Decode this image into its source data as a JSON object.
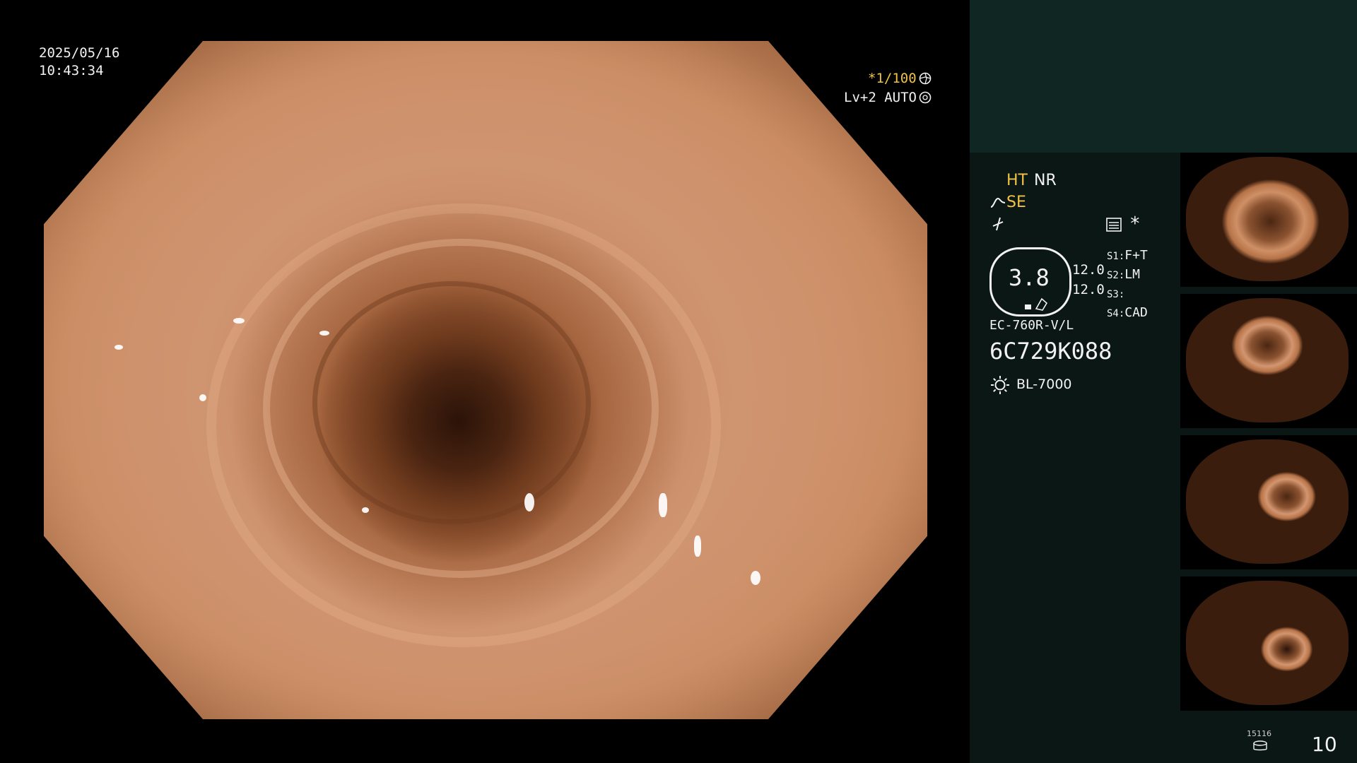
{
  "datetime": {
    "date": "2025/05/16",
    "time": "10:43:34"
  },
  "shutter": {
    "value": "*1/100",
    "icon": "shutter-icon"
  },
  "iris": {
    "value": "Lv+2 AUTO",
    "icon": "iris-icon"
  },
  "enhancement": {
    "ht": "HT",
    "nr": "NR",
    "se": "SE",
    "se_icon": "enhance-curve-icon",
    "color_icon": "color-mode-icon",
    "aux_icon": "image-mode-icon",
    "star": "*"
  },
  "zoom": {
    "value": "3.8",
    "ratio_a": "12.0",
    "ratio_b": "12.0"
  },
  "switches": [
    {
      "key": "S1:",
      "value": "F+T"
    },
    {
      "key": "S2:",
      "value": "LM"
    },
    {
      "key": "S3:",
      "value": ""
    },
    {
      "key": "S4:",
      "value": "CAD"
    }
  ],
  "scope": {
    "model": "EC-760R-V/L",
    "serial": "6C729K088"
  },
  "light_source": {
    "name": "BL-7000",
    "icon": "light-source-icon"
  },
  "capture": {
    "count_label": "15116",
    "count_icon": "storage-icon",
    "frame_number": "10"
  },
  "colors": {
    "accent_yellow": "#f0c246",
    "panel_bg": "#0b1715",
    "panel_top": "#102623"
  }
}
